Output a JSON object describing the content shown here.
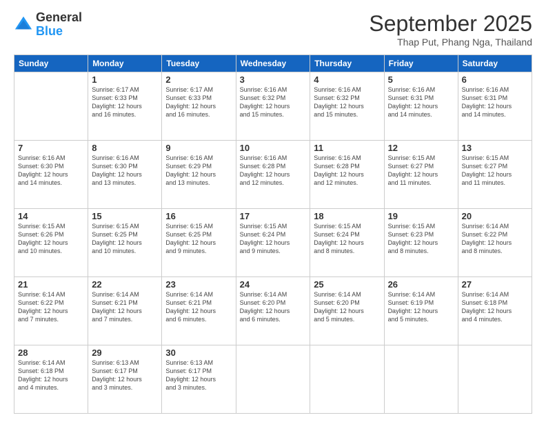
{
  "logo": {
    "general": "General",
    "blue": "Blue"
  },
  "title": "September 2025",
  "subtitle": "Thap Put, Phang Nga, Thailand",
  "days_of_week": [
    "Sunday",
    "Monday",
    "Tuesday",
    "Wednesday",
    "Thursday",
    "Friday",
    "Saturday"
  ],
  "weeks": [
    [
      {
        "day": "",
        "info": ""
      },
      {
        "day": "1",
        "info": "Sunrise: 6:17 AM\nSunset: 6:33 PM\nDaylight: 12 hours\nand 16 minutes."
      },
      {
        "day": "2",
        "info": "Sunrise: 6:17 AM\nSunset: 6:33 PM\nDaylight: 12 hours\nand 16 minutes."
      },
      {
        "day": "3",
        "info": "Sunrise: 6:16 AM\nSunset: 6:32 PM\nDaylight: 12 hours\nand 15 minutes."
      },
      {
        "day": "4",
        "info": "Sunrise: 6:16 AM\nSunset: 6:32 PM\nDaylight: 12 hours\nand 15 minutes."
      },
      {
        "day": "5",
        "info": "Sunrise: 6:16 AM\nSunset: 6:31 PM\nDaylight: 12 hours\nand 14 minutes."
      },
      {
        "day": "6",
        "info": "Sunrise: 6:16 AM\nSunset: 6:31 PM\nDaylight: 12 hours\nand 14 minutes."
      }
    ],
    [
      {
        "day": "7",
        "info": "Sunrise: 6:16 AM\nSunset: 6:30 PM\nDaylight: 12 hours\nand 14 minutes."
      },
      {
        "day": "8",
        "info": "Sunrise: 6:16 AM\nSunset: 6:30 PM\nDaylight: 12 hours\nand 13 minutes."
      },
      {
        "day": "9",
        "info": "Sunrise: 6:16 AM\nSunset: 6:29 PM\nDaylight: 12 hours\nand 13 minutes."
      },
      {
        "day": "10",
        "info": "Sunrise: 6:16 AM\nSunset: 6:28 PM\nDaylight: 12 hours\nand 12 minutes."
      },
      {
        "day": "11",
        "info": "Sunrise: 6:16 AM\nSunset: 6:28 PM\nDaylight: 12 hours\nand 12 minutes."
      },
      {
        "day": "12",
        "info": "Sunrise: 6:15 AM\nSunset: 6:27 PM\nDaylight: 12 hours\nand 11 minutes."
      },
      {
        "day": "13",
        "info": "Sunrise: 6:15 AM\nSunset: 6:27 PM\nDaylight: 12 hours\nand 11 minutes."
      }
    ],
    [
      {
        "day": "14",
        "info": "Sunrise: 6:15 AM\nSunset: 6:26 PM\nDaylight: 12 hours\nand 10 minutes."
      },
      {
        "day": "15",
        "info": "Sunrise: 6:15 AM\nSunset: 6:25 PM\nDaylight: 12 hours\nand 10 minutes."
      },
      {
        "day": "16",
        "info": "Sunrise: 6:15 AM\nSunset: 6:25 PM\nDaylight: 12 hours\nand 9 minutes."
      },
      {
        "day": "17",
        "info": "Sunrise: 6:15 AM\nSunset: 6:24 PM\nDaylight: 12 hours\nand 9 minutes."
      },
      {
        "day": "18",
        "info": "Sunrise: 6:15 AM\nSunset: 6:24 PM\nDaylight: 12 hours\nand 8 minutes."
      },
      {
        "day": "19",
        "info": "Sunrise: 6:15 AM\nSunset: 6:23 PM\nDaylight: 12 hours\nand 8 minutes."
      },
      {
        "day": "20",
        "info": "Sunrise: 6:14 AM\nSunset: 6:22 PM\nDaylight: 12 hours\nand 8 minutes."
      }
    ],
    [
      {
        "day": "21",
        "info": "Sunrise: 6:14 AM\nSunset: 6:22 PM\nDaylight: 12 hours\nand 7 minutes."
      },
      {
        "day": "22",
        "info": "Sunrise: 6:14 AM\nSunset: 6:21 PM\nDaylight: 12 hours\nand 7 minutes."
      },
      {
        "day": "23",
        "info": "Sunrise: 6:14 AM\nSunset: 6:21 PM\nDaylight: 12 hours\nand 6 minutes."
      },
      {
        "day": "24",
        "info": "Sunrise: 6:14 AM\nSunset: 6:20 PM\nDaylight: 12 hours\nand 6 minutes."
      },
      {
        "day": "25",
        "info": "Sunrise: 6:14 AM\nSunset: 6:20 PM\nDaylight: 12 hours\nand 5 minutes."
      },
      {
        "day": "26",
        "info": "Sunrise: 6:14 AM\nSunset: 6:19 PM\nDaylight: 12 hours\nand 5 minutes."
      },
      {
        "day": "27",
        "info": "Sunrise: 6:14 AM\nSunset: 6:18 PM\nDaylight: 12 hours\nand 4 minutes."
      }
    ],
    [
      {
        "day": "28",
        "info": "Sunrise: 6:14 AM\nSunset: 6:18 PM\nDaylight: 12 hours\nand 4 minutes."
      },
      {
        "day": "29",
        "info": "Sunrise: 6:13 AM\nSunset: 6:17 PM\nDaylight: 12 hours\nand 3 minutes."
      },
      {
        "day": "30",
        "info": "Sunrise: 6:13 AM\nSunset: 6:17 PM\nDaylight: 12 hours\nand 3 minutes."
      },
      {
        "day": "",
        "info": ""
      },
      {
        "day": "",
        "info": ""
      },
      {
        "day": "",
        "info": ""
      },
      {
        "day": "",
        "info": ""
      }
    ]
  ]
}
